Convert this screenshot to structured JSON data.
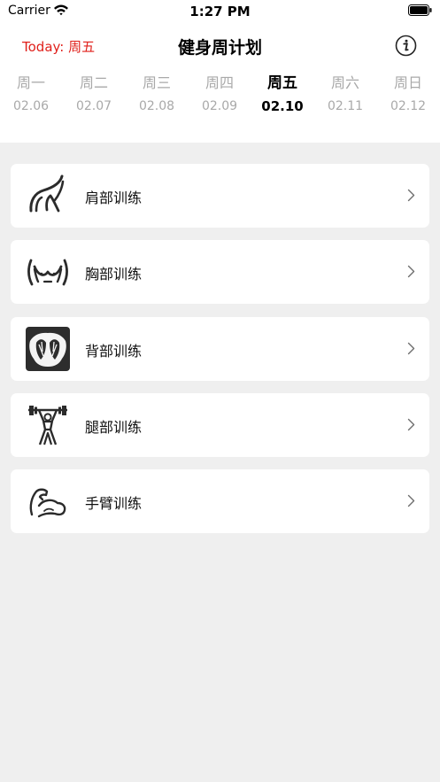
{
  "status_bar": {
    "carrier": "Carrier",
    "time": "1:27 PM"
  },
  "header": {
    "today": "Today: 周五",
    "title": "健身周计划",
    "info_icon": "info-circle-icon"
  },
  "week": [
    {
      "name": "周一",
      "date": "02.06",
      "active": false
    },
    {
      "name": "周二",
      "date": "02.07",
      "active": false
    },
    {
      "name": "周三",
      "date": "02.08",
      "active": false
    },
    {
      "name": "周四",
      "date": "02.09",
      "active": false
    },
    {
      "name": "周五",
      "date": "02.10",
      "active": true
    },
    {
      "name": "周六",
      "date": "02.11",
      "active": false
    },
    {
      "name": "周日",
      "date": "02.12",
      "active": false
    }
  ],
  "workouts": [
    {
      "label": "肩部训练",
      "icon": "shoulder-icon"
    },
    {
      "label": "胸部训练",
      "icon": "chest-icon"
    },
    {
      "label": "背部训练",
      "icon": "back-icon"
    },
    {
      "label": "腿部训练",
      "icon": "weightlifter-icon"
    },
    {
      "label": "手臂训练",
      "icon": "arm-icon"
    }
  ],
  "colors": {
    "accent_red": "#e0201b",
    "inactive_gray": "#a9a9a9",
    "background": "#efefef"
  }
}
